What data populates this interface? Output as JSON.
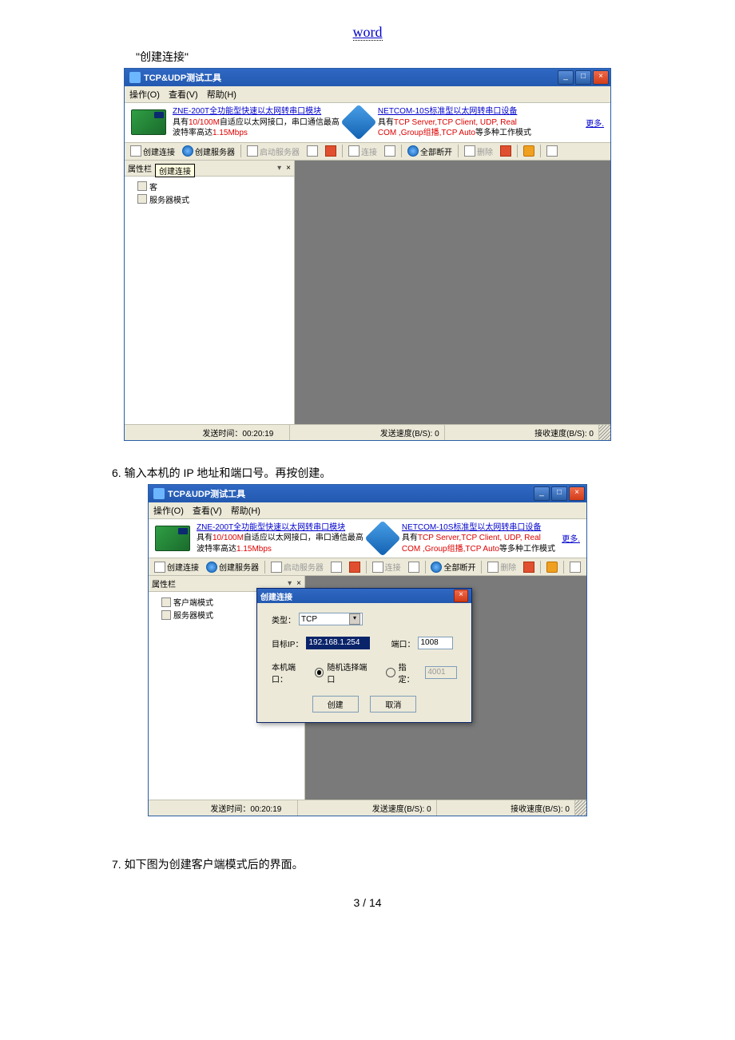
{
  "doc": {
    "header_link": "word",
    "caption1": "\"创建连接\"",
    "caption6": "6. 输入本机的 IP 地址和端口号。再按创建。",
    "caption7": "7. 如下图为创建客户端模式后的界面。",
    "page_num": "3 / 14"
  },
  "app": {
    "title": "TCP&UDP测试工具",
    "menu": {
      "op": "操作(O)",
      "view": "查看(V)",
      "help": "帮助(H)"
    },
    "banner": {
      "left_link": "ZNE-200T全功能型快速以太网转串口模块",
      "left_l1_a": "具有",
      "left_l1_red": "10/100M",
      "left_l1_b": "自适应以太网接口，串口通信最高",
      "left_l2_a": "波特率高达",
      "left_l2_red": "1.15Mbps",
      "right_link": "NETCOM-10S标准型以太网转串口设备",
      "right_l1_a": "具有",
      "right_l1_red": "TCP Server,TCP Client, UDP, Real",
      "right_l2_red": "COM ,Group组播,TCP Auto",
      "right_l2_b": "等多种工作模式",
      "more": "更多."
    },
    "toolbar": {
      "create_conn": "创建连接",
      "create_server": "创建服务器",
      "start_server": "启动服务器",
      "connect": "连接",
      "disconnect_all": "全部断开",
      "delete": "删除"
    },
    "side": {
      "title": "属性栏",
      "pin": "▾",
      "close": "×",
      "client": "客户端模式",
      "server": "服务器模式",
      "tooltip": "创建连接",
      "client_short": "客"
    },
    "status": {
      "send_time_lbl": "发送时间：",
      "send_time": "00:20:19",
      "send_rate": "发送速度(B/S): 0",
      "recv_rate": "接收速度(B/S): 0"
    }
  },
  "dlg": {
    "title": "创建连接",
    "type_lbl": "类型：",
    "type_val": "TCP",
    "ip_lbl": "目标IP：",
    "ip_val": "192.168.1.254",
    "port_lbl": "端口：",
    "port_val": "1008",
    "local_lbl": "本机端口：",
    "rand": "随机选择端口",
    "fixed": "指定：",
    "fixed_val": "4001",
    "create": "创建",
    "cancel": "取消"
  }
}
